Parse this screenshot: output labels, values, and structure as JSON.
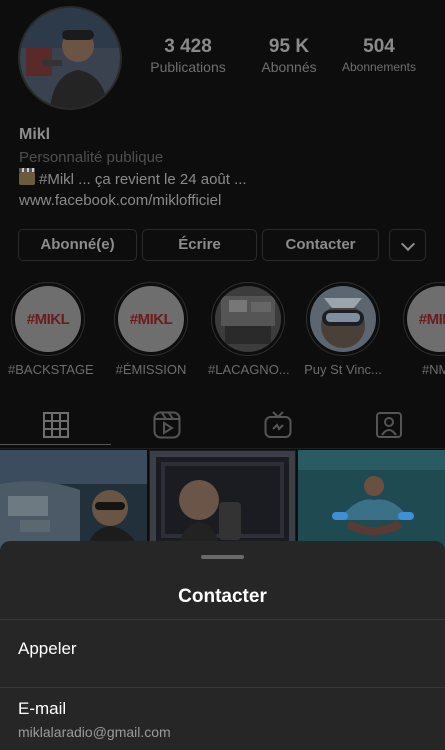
{
  "profile": {
    "name": "Mikl",
    "category": "Personnalité publique",
    "bio": "#Mikl ... ça revient le 24 août ...",
    "link": "www.facebook.com/miklofficiel",
    "stats": {
      "posts": {
        "value": "3 428",
        "label": "Publications"
      },
      "followers": {
        "value": "95 K",
        "label": "Abonnés"
      },
      "following": {
        "value": "504",
        "label": "Abonnements"
      }
    }
  },
  "actions": {
    "following_label": "Abonné(e)",
    "message_label": "Écrire",
    "contact_label": "Contacter",
    "more_icon": "chevron-down-icon"
  },
  "highlights": [
    {
      "label": "#BACKSTAGE",
      "logo": "#MIKL"
    },
    {
      "label": "#ÉMISSION",
      "logo": "#MIKL"
    },
    {
      "label": "#LACAGNO..."
    },
    {
      "label": "Puy St Vinc..."
    },
    {
      "label": "#NMA",
      "logo": "#MIKL"
    }
  ],
  "tabs": [
    {
      "icon": "grid-icon"
    },
    {
      "icon": "reels-icon"
    },
    {
      "icon": "igtv-icon"
    },
    {
      "icon": "tagged-icon"
    }
  ],
  "sheet": {
    "title": "Contacter",
    "options": [
      {
        "label": "Appeler"
      },
      {
        "label": "E-mail",
        "detail": "miklalaradio@gmail.com"
      }
    ]
  },
  "colors": {
    "background": "#000000",
    "sheet": "#262626",
    "logo_red": "#c11e24"
  }
}
